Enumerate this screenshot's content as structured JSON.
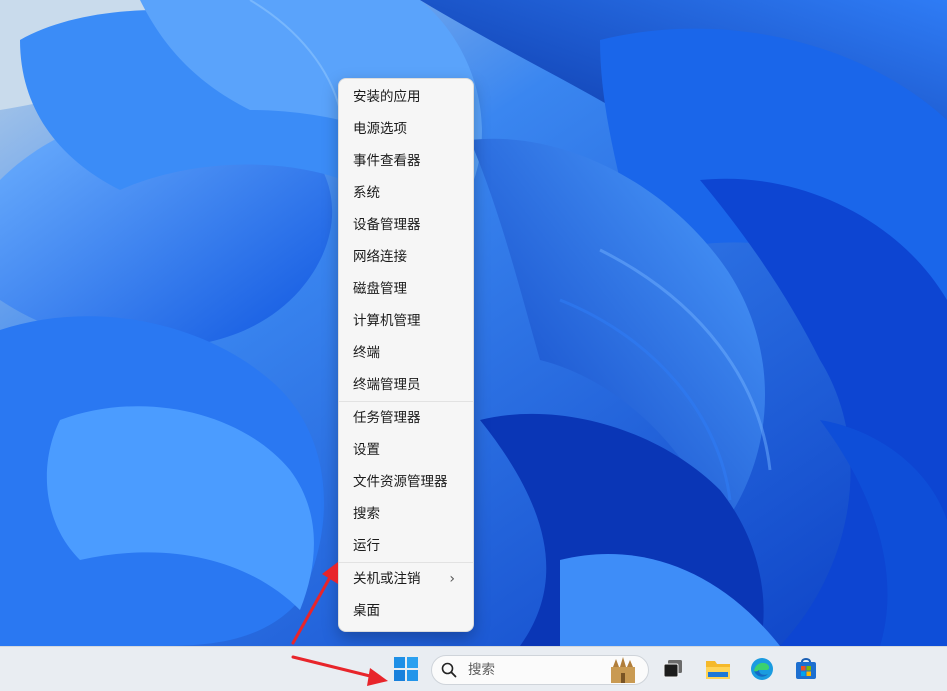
{
  "menu": {
    "items": [
      {
        "label": "安装的应用"
      },
      {
        "label": "电源选项"
      },
      {
        "label": "事件查看器"
      },
      {
        "label": "系统"
      },
      {
        "label": "设备管理器"
      },
      {
        "label": "网络连接"
      },
      {
        "label": "磁盘管理"
      },
      {
        "label": "计算机管理"
      },
      {
        "label": "终端"
      },
      {
        "label": "终端管理员"
      },
      {
        "label": "任务管理器"
      },
      {
        "label": "设置"
      },
      {
        "label": "文件资源管理器"
      },
      {
        "label": "搜索"
      },
      {
        "label": "运行"
      },
      {
        "label": "关机或注销",
        "submenu_indicator": "›"
      },
      {
        "label": "桌面"
      }
    ]
  },
  "taskbar": {
    "search": {
      "placeholder": "搜索",
      "icon": "search-icon"
    },
    "icons": [
      "windows-start-icon",
      "task-view-icon",
      "file-explorer-icon",
      "edge-browser-icon",
      "microsoft-store-icon"
    ]
  },
  "annotations": {
    "arrow_color": "#e8252b"
  },
  "colors": {
    "wallpaper": "#1a5fd9",
    "taskbar": "#e9edf2",
    "menu": "#f6f6f6"
  }
}
